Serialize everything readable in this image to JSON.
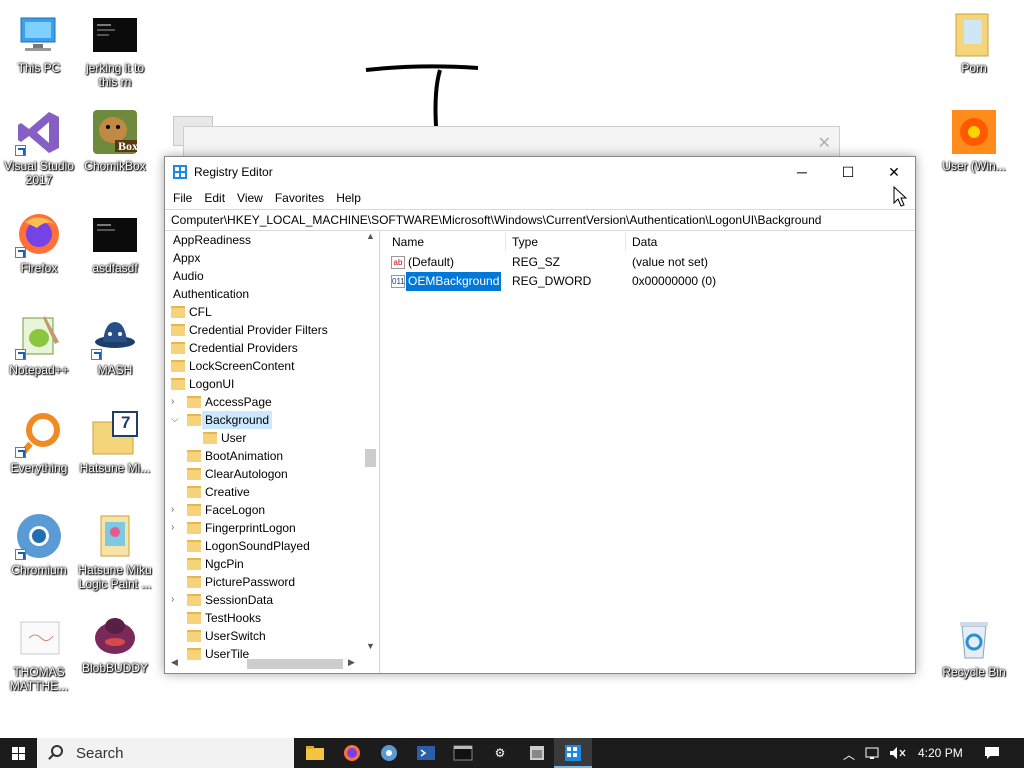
{
  "desktop": {
    "icons": [
      {
        "label": "This PC"
      },
      {
        "label": "jerking it to this rn"
      },
      {
        "label": "Visual Studio 2017"
      },
      {
        "label": "ChomikBox"
      },
      {
        "label": "Firefox"
      },
      {
        "label": "asdfasdf"
      },
      {
        "label": "Notepad++"
      },
      {
        "label": "MASH"
      },
      {
        "label": "Everything"
      },
      {
        "label": "Hatsune Mi..."
      },
      {
        "label": "Chromium"
      },
      {
        "label": "Hatsune Miku Logic Paint ..."
      },
      {
        "label": "THOMAS MATTHE..."
      },
      {
        "label": "BlobBUDDY"
      },
      {
        "label": "Porn"
      },
      {
        "label": "User (Win..."
      },
      {
        "label": "Recycle Bin"
      }
    ],
    "chomik_badge": "Box",
    "hatsune_badge": "7"
  },
  "window": {
    "title": "Registry Editor",
    "menu": [
      "File",
      "Edit",
      "View",
      "Favorites",
      "Help"
    ],
    "address": "Computer\\HKEY_LOCAL_MACHINE\\SOFTWARE\\Microsoft\\Windows\\CurrentVersion\\Authentication\\LogonUI\\Background"
  },
  "tree": [
    {
      "label": "AppReadiness",
      "level": 0
    },
    {
      "label": "Appx",
      "level": 0
    },
    {
      "label": "Audio",
      "level": 0
    },
    {
      "label": "Authentication",
      "level": 0
    },
    {
      "label": "CFL",
      "level": 1
    },
    {
      "label": "Credential Provider Filters",
      "level": 1
    },
    {
      "label": "Credential Providers",
      "level": 1
    },
    {
      "label": "LockScreenContent",
      "level": 1
    },
    {
      "label": "LogonUI",
      "level": 1
    },
    {
      "label": "AccessPage",
      "level": 2,
      "arrow": "right"
    },
    {
      "label": "Background",
      "level": 2,
      "arrow": "down",
      "selected": true
    },
    {
      "label": "User",
      "level": 3
    },
    {
      "label": "BootAnimation",
      "level": 2
    },
    {
      "label": "ClearAutologon",
      "level": 2
    },
    {
      "label": "Creative",
      "level": 2
    },
    {
      "label": "FaceLogon",
      "level": 2,
      "arrow": "right"
    },
    {
      "label": "FingerprintLogon",
      "level": 2,
      "arrow": "right"
    },
    {
      "label": "LogonSoundPlayed",
      "level": 2
    },
    {
      "label": "NgcPin",
      "level": 2
    },
    {
      "label": "PicturePassword",
      "level": 2
    },
    {
      "label": "SessionData",
      "level": 2,
      "arrow": "right"
    },
    {
      "label": "TestHooks",
      "level": 2
    },
    {
      "label": "UserSwitch",
      "level": 2
    },
    {
      "label": "UserTile",
      "level": 2
    }
  ],
  "list": {
    "headers": [
      "Name",
      "Type",
      "Data"
    ],
    "rows": [
      {
        "name": "(Default)",
        "type": "REG_SZ",
        "data": "(value not set)",
        "icon": "ab"
      },
      {
        "name": "OEMBackground",
        "type": "REG_DWORD",
        "data": "0x00000000 (0)",
        "icon": "011",
        "selected": true
      }
    ]
  },
  "taskbar": {
    "search_placeholder": "Search",
    "clock": "4:20 PM"
  }
}
